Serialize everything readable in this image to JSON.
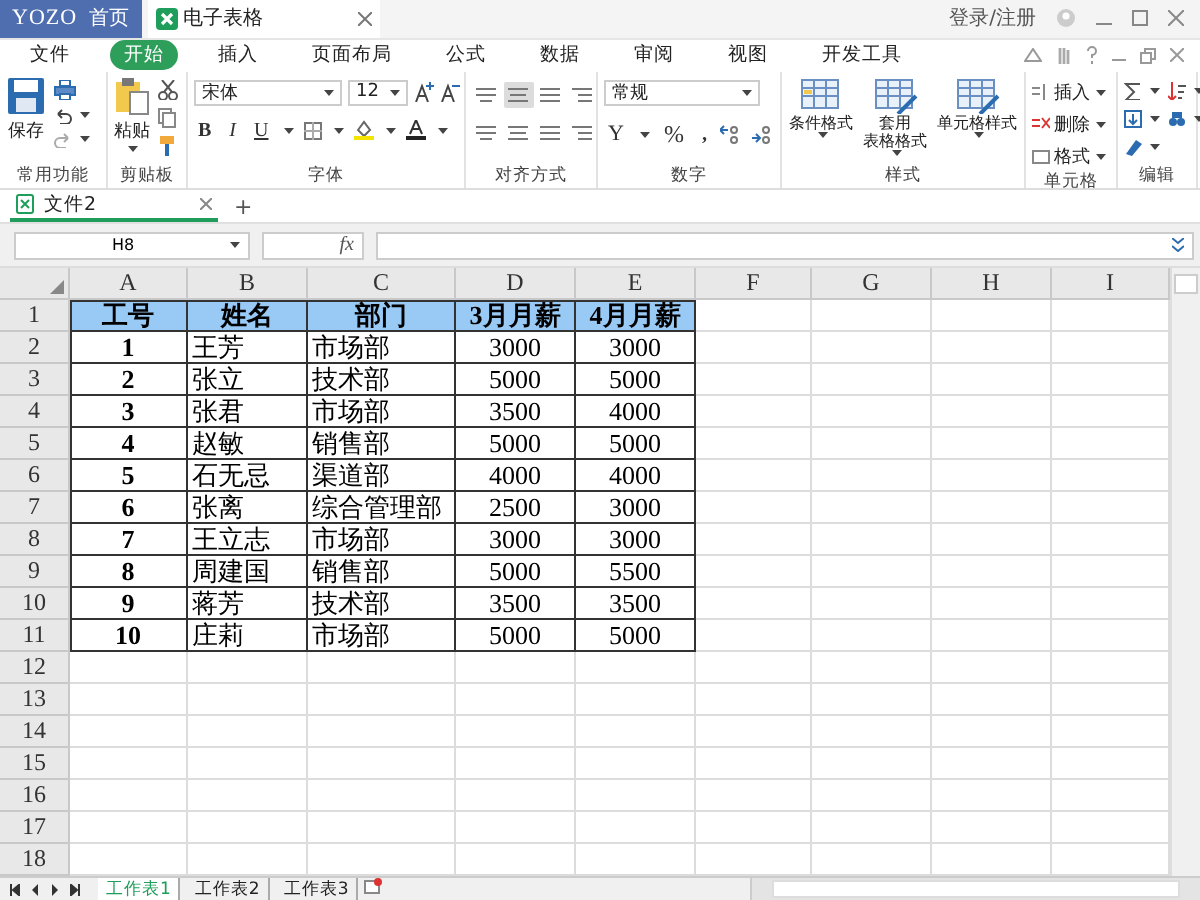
{
  "titlebar": {
    "logo": "YOZO",
    "home": "首页",
    "doc_tab": "电子表格",
    "login": "登录/注册"
  },
  "menu": [
    {
      "label": "文件",
      "selected": false
    },
    {
      "label": "开始",
      "selected": true
    },
    {
      "label": "插入",
      "selected": false
    },
    {
      "label": "页面布局",
      "selected": false
    },
    {
      "label": "公式",
      "selected": false
    },
    {
      "label": "数据",
      "selected": false
    },
    {
      "label": "审阅",
      "selected": false
    },
    {
      "label": "视图",
      "selected": false
    },
    {
      "label": "开发工具",
      "selected": false
    }
  ],
  "ribbon": {
    "common": {
      "title": "常用功能",
      "save": "保存"
    },
    "clipboard": {
      "title": "剪贴板",
      "paste": "粘贴"
    },
    "font": {
      "title": "字体",
      "font_name": "宋体",
      "font_size": "12",
      "bold": "B",
      "italic": "I",
      "underline": "U"
    },
    "align": {
      "title": "对齐方式",
      "buttons": [
        {
          "selected": false
        },
        {
          "selected": true
        },
        {
          "selected": false
        },
        {
          "selected": false
        },
        {
          "selected": false
        },
        {
          "selected": false
        },
        {
          "selected": false
        },
        {
          "selected": false
        }
      ]
    },
    "number": {
      "title": "数字",
      "format": "常规",
      "currency": "Y",
      "percent": "%",
      "comma": ","
    },
    "styles": {
      "title": "样式",
      "buttons": [
        {
          "lines": [
            "条件格式"
          ]
        },
        {
          "lines": [
            "套用",
            "表格格式"
          ]
        },
        {
          "lines": [
            "单元格样式"
          ]
        }
      ]
    },
    "cells": {
      "title": "单元格",
      "buttons": [
        "插入",
        "删除",
        "格式"
      ]
    },
    "edit": {
      "title": "编辑"
    }
  },
  "doc_tabs": [
    {
      "label": "文件2",
      "selected": true
    }
  ],
  "new_tab": "+",
  "formula_bar": {
    "name_box": "H8",
    "fx": "fx"
  },
  "sheet": {
    "columns": [
      "A",
      "B",
      "C",
      "D",
      "E",
      "F",
      "G",
      "H",
      "I"
    ],
    "rows": [
      {
        "number": "1",
        "kind": "header",
        "cells": [
          "工号",
          "姓名",
          "部门",
          "3月月薪",
          "4月月薪"
        ]
      },
      {
        "number": "2",
        "kind": "data",
        "cells": [
          "1",
          "王芳",
          "市场部",
          "3000",
          "3000"
        ]
      },
      {
        "number": "3",
        "kind": "data",
        "cells": [
          "2",
          "张立",
          "技术部",
          "5000",
          "5000"
        ]
      },
      {
        "number": "4",
        "kind": "data",
        "cells": [
          "3",
          "张君",
          "市场部",
          "3500",
          "4000"
        ]
      },
      {
        "number": "5",
        "kind": "data",
        "cells": [
          "4",
          "赵敏",
          "销售部",
          "5000",
          "5000"
        ]
      },
      {
        "number": "6",
        "kind": "data",
        "cells": [
          "5",
          "石无忌",
          "渠道部",
          "4000",
          "4000"
        ]
      },
      {
        "number": "7",
        "kind": "data",
        "cells": [
          "6",
          "张离",
          "综合管理部",
          "2500",
          "3000"
        ]
      },
      {
        "number": "8",
        "kind": "data",
        "cells": [
          "7",
          "王立志",
          "市场部",
          "3000",
          "3000"
        ]
      },
      {
        "number": "9",
        "kind": "data",
        "cells": [
          "8",
          "周建国",
          "销售部",
          "5000",
          "5500"
        ]
      },
      {
        "number": "10",
        "kind": "data",
        "cells": [
          "9",
          "蒋芳",
          "技术部",
          "3500",
          "3500"
        ]
      },
      {
        "number": "11",
        "kind": "data",
        "cells": [
          "10",
          "庄莉",
          "市场部",
          "5000",
          "5000"
        ]
      },
      {
        "number": "12",
        "kind": "empty"
      },
      {
        "number": "13",
        "kind": "empty"
      },
      {
        "number": "14",
        "kind": "empty"
      },
      {
        "number": "15",
        "kind": "empty"
      },
      {
        "number": "16",
        "kind": "empty"
      },
      {
        "number": "17",
        "kind": "empty"
      },
      {
        "number": "18",
        "kind": "empty"
      }
    ]
  },
  "sheet_tabs": [
    {
      "label": "工作表1",
      "selected": true
    },
    {
      "label": "工作表2",
      "selected": false
    },
    {
      "label": "工作表3",
      "selected": false
    }
  ]
}
